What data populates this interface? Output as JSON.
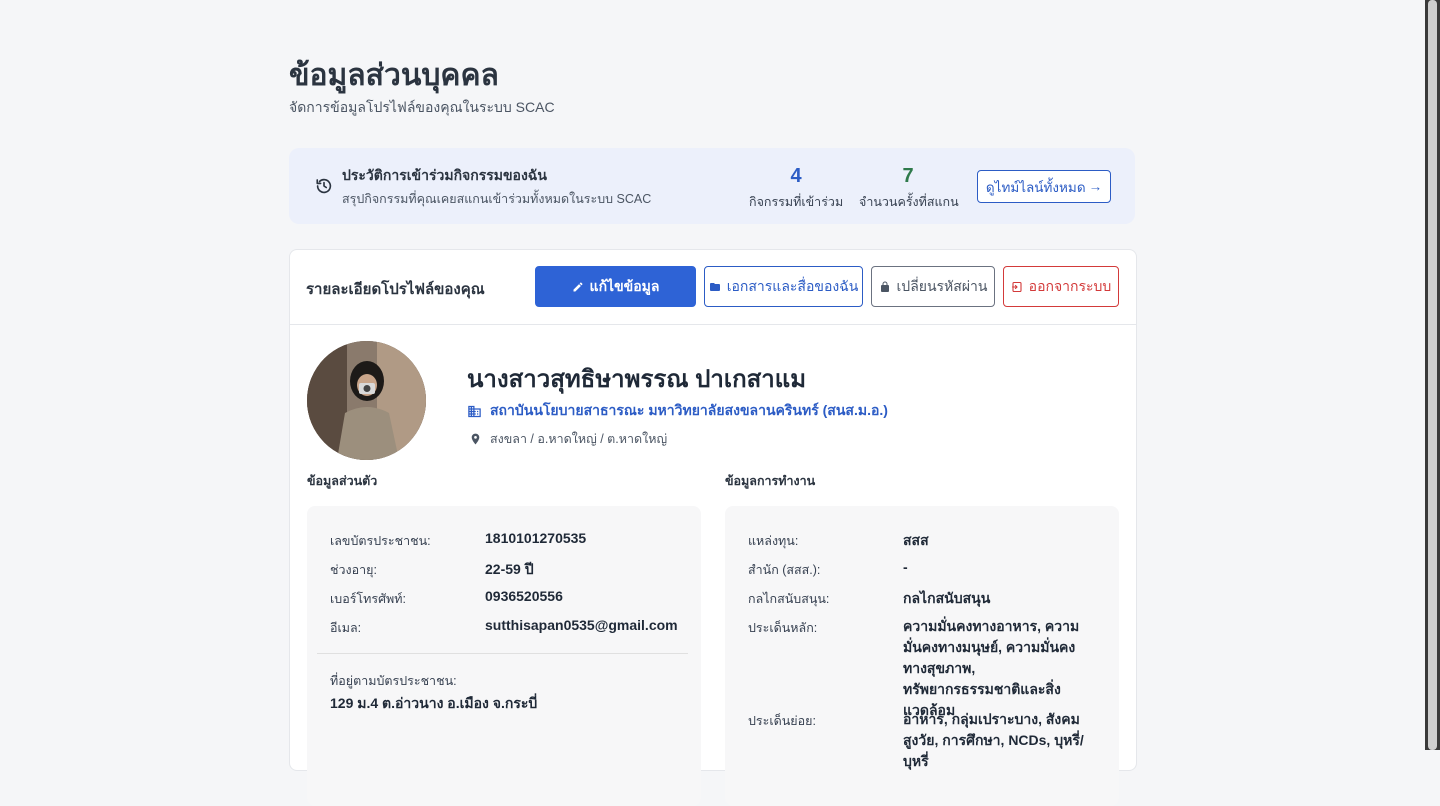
{
  "page": {
    "title": "ข้อมูลส่วนบุคคล",
    "subtitle": "จัดการข้อมูลโปรไฟล์ของคุณในระบบ SCAC"
  },
  "history": {
    "icon": "history-icon",
    "title": "ประวัติการเข้าร่วมกิจกรรมของฉัน",
    "subtitle": "สรุปกิจกรรมที่คุณเคยสแกนเข้าร่วมทั้งหมดในระบบ SCAC",
    "activities_count": "4",
    "activities_label": "กิจกรรมที่เข้าร่วม",
    "scans_count": "7",
    "scans_label": "จำนวนครั้งที่สแกน",
    "timeline_button": "ดูไทม์ไลน์ทั้งหมด",
    "timeline_arrow": "→"
  },
  "profile_card": {
    "title": "รายละเอียดโปรไฟล์ของคุณ",
    "edit_button": "แก้ไขข้อมูล",
    "docs_button": "เอกสารและสื่อของฉัน",
    "password_button": "เปลี่ยนรหัสผ่าน",
    "logout_button": "ออกจากระบบ"
  },
  "user": {
    "name": "นางสาวสุทธิษาพรรณ ปาเกสาแม",
    "organization": "สถาบันนโยบายสาธารณะ มหาวิทยาลัยสงขลานครินทร์ (สนส.ม.อ.)",
    "location": "สงขลา / อ.หาดใหญ่ / ต.หาดใหญ่"
  },
  "personal": {
    "section_label": "ข้อมูลส่วนตัว",
    "id_card_label": "เลขบัตรประชาชน:",
    "id_card_value": "1810101270535",
    "age_label": "ช่วงอายุ:",
    "age_value": "22-59 ปี",
    "phone_label": "เบอร์โทรศัพท์:",
    "phone_value": "0936520556",
    "email_label": "อีเมล:",
    "email_value": "sutthisapan0535@gmail.com",
    "address_label": "ที่อยู่ตามบัตรประชาชน:",
    "address_value": "129 ม.4 ต.อ่าวนาง อ.เมือง จ.กระบี่"
  },
  "work": {
    "section_label": "ข้อมูลการทำงาน",
    "fund_label": "แหล่งทุน:",
    "fund_value": "สสส",
    "office_label": "สำนัก (สสส.):",
    "office_value": "-",
    "mechanism_label": "กลไกสนับสนุน:",
    "mechanism_value": "กลไกสนับสนุน",
    "main_issue_label": "ประเด็นหลัก:",
    "main_issue_value": "ความมั่นคงทางอาหาร, ความมั่นคงทางมนุษย์, ความมั่นคงทางสุขภาพ, ทรัพยากรธรรมชาติและสิ่งแวดล้อม",
    "sub_issue_label": "ประเด็นย่อย:",
    "sub_issue_value": "อาหาร, กลุ่มเปราะบาง, สังคมสูงวัย, การศึกษา, NCDs, บุหรี่/บุหรี่"
  },
  "colors": {
    "primary": "#2e63d6",
    "success": "#2f7a4b",
    "danger": "#d33a3a"
  }
}
